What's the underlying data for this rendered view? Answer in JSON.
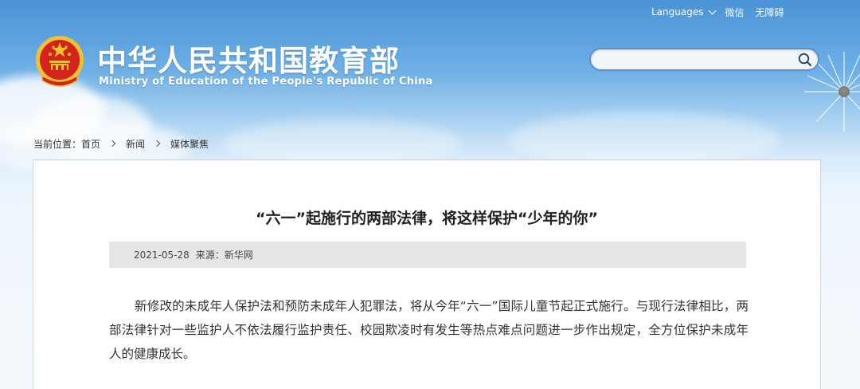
{
  "topbar": {
    "languages_label": "Languages",
    "link1": "微信",
    "link2": "无障碍"
  },
  "header": {
    "title_cn": "中华人民共和国教育部",
    "title_en": "Ministry of Education of the People's Republic of China"
  },
  "search": {
    "value": "",
    "placeholder": ""
  },
  "breadcrumb": {
    "prefix": "当前位置：",
    "items": [
      "首页",
      "新闻",
      "媒体聚焦"
    ]
  },
  "article": {
    "title": "“六一”起施行的两部法律，将这样保护“少年的你”",
    "date": "2021-05-28",
    "source": "来源：新华网",
    "body": "新修改的未成年人保护法和预防未成年人犯罪法，将从今年“六一”国际儿童节起正式施行。与现行法律相比，两部法律针对一些监护人不依法履行监护责任、校园欺凌时有发生等热点难点问题进一步作出规定，全方位保护未成年人的健康成长。"
  },
  "colors": {
    "sky_top": "#4a93d6",
    "search_border": "#5b8fd0",
    "meta_bg": "#e6e6e6",
    "emblem_red": "#d4231d",
    "emblem_gold": "#f2c230"
  }
}
